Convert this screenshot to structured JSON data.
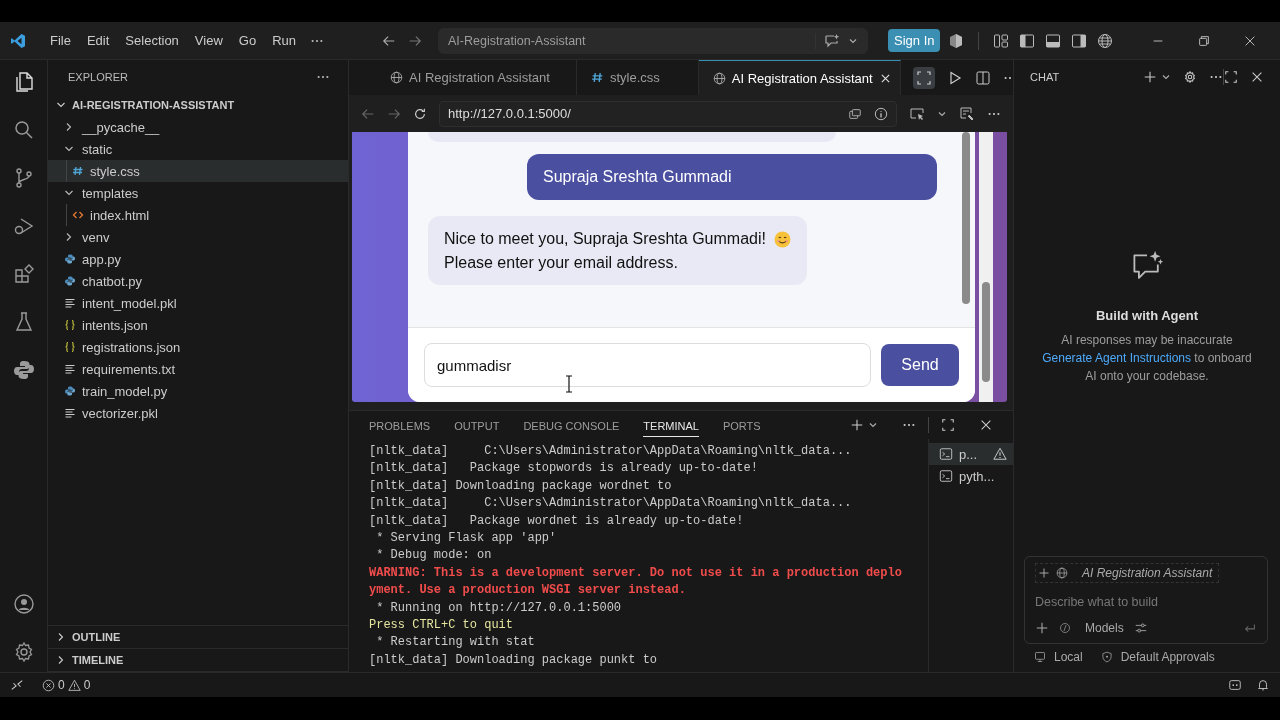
{
  "title_bar": {
    "menu": [
      "File",
      "Edit",
      "Selection",
      "View",
      "Go",
      "Run"
    ],
    "command_center": "AI-Registration-Assistant",
    "sign_in": "Sign In"
  },
  "explorer": {
    "title": "EXPLORER",
    "root": {
      "label": "AI-REGISTRATION-ASSISTANT",
      "expanded": true
    },
    "items": [
      {
        "label": "__pycache__",
        "kind": "folder",
        "expanded": false,
        "selected": false
      },
      {
        "label": "static",
        "kind": "folder",
        "expanded": true,
        "selected": false,
        "children": [
          {
            "label": "style.css",
            "kind": "css",
            "selected": true
          }
        ]
      },
      {
        "label": "templates",
        "kind": "folder",
        "expanded": true,
        "selected": false,
        "children": [
          {
            "label": "index.html",
            "kind": "html",
            "selected": false
          }
        ]
      },
      {
        "label": "venv",
        "kind": "folder",
        "expanded": false,
        "selected": false
      },
      {
        "label": "app.py",
        "kind": "python",
        "selected": false
      },
      {
        "label": "chatbot.py",
        "kind": "python",
        "selected": false
      },
      {
        "label": "intent_model.pkl",
        "kind": "text",
        "selected": false
      },
      {
        "label": "intents.json",
        "kind": "json",
        "selected": false
      },
      {
        "label": "registrations.json",
        "kind": "json",
        "selected": false
      },
      {
        "label": "requirements.txt",
        "kind": "text",
        "selected": false
      },
      {
        "label": "train_model.py",
        "kind": "python",
        "selected": false
      },
      {
        "label": "vectorizer.pkl",
        "kind": "text",
        "selected": false
      }
    ],
    "sections": [
      {
        "label": "OUTLINE",
        "expanded": false
      },
      {
        "label": "TIMELINE",
        "expanded": false
      }
    ]
  },
  "editor": {
    "tabs": [
      {
        "label": "AI Registration Assistant",
        "kind": "web",
        "selected": false
      },
      {
        "label": "style.css",
        "kind": "css",
        "selected": false
      },
      {
        "label": "AI Registration Assistant",
        "kind": "web",
        "selected": true
      }
    ],
    "browser": {
      "url": "http://127.0.0.1:5000/",
      "messages": [
        {
          "kind": "user",
          "lines": [
            "Supraja Sreshta Gummadi"
          ]
        },
        {
          "kind": "bot",
          "lines": [
            "Nice to meet you, Supraja Sreshta Gummadi!",
            "Please enter your email address."
          ],
          "emoji": true
        }
      ],
      "input_value": "gummadisr",
      "send": "Send"
    }
  },
  "panel": {
    "tabs": [
      {
        "label": "PROBLEMS",
        "selected": false
      },
      {
        "label": "OUTPUT",
        "selected": false
      },
      {
        "label": "DEBUG CONSOLE",
        "selected": false
      },
      {
        "label": "TERMINAL",
        "selected": true
      },
      {
        "label": "PORTS",
        "selected": false
      }
    ],
    "terminal_lines": [
      {
        "kind": "normal",
        "text": "[nltk_data]     C:\\Users\\Administrator\\AppData\\Roaming\\nltk_data..."
      },
      {
        "kind": "normal",
        "text": "[nltk_data]   Package stopwords is already up-to-date!"
      },
      {
        "kind": "normal",
        "text": "[nltk_data] Downloading package wordnet to"
      },
      {
        "kind": "normal",
        "text": "[nltk_data]     C:\\Users\\Administrator\\AppData\\Roaming\\nltk_data..."
      },
      {
        "kind": "normal",
        "text": "[nltk_data]   Package wordnet is already up-to-date!"
      },
      {
        "kind": "normal",
        "text": " * Serving Flask app 'app'"
      },
      {
        "kind": "normal",
        "text": " * Debug mode: on"
      },
      {
        "kind": "warning",
        "text": "WARNING: This is a development server. Do not use it in a production deplo"
      },
      {
        "kind": "warning",
        "text": "yment. Use a production WSGI server instead."
      },
      {
        "kind": "normal",
        "text": " * Running on http://127.0.0.1:5000"
      },
      {
        "kind": "notice",
        "text": "Press CTRL+C to quit"
      },
      {
        "kind": "normal",
        "text": " * Restarting with stat"
      },
      {
        "kind": "normal",
        "text": "[nltk_data] Downloading package punkt to"
      }
    ],
    "sessions": [
      {
        "label": "p...",
        "selected": true,
        "warning": true
      },
      {
        "label": "pyth...",
        "selected": false,
        "warning": false
      }
    ]
  },
  "chat": {
    "title": "CHAT",
    "heading": "Build with Agent",
    "note": "AI responses may be inaccurate",
    "link": "Generate Agent Instructions",
    "link_rest": "to onboard AI onto your codebase.",
    "context": "AI Registration Assistant",
    "placeholder": "Describe what to build",
    "models": "Models",
    "footer": [
      "Local",
      "Default Approvals"
    ]
  },
  "status_bar": {
    "errors": "0",
    "warnings": "0"
  }
}
